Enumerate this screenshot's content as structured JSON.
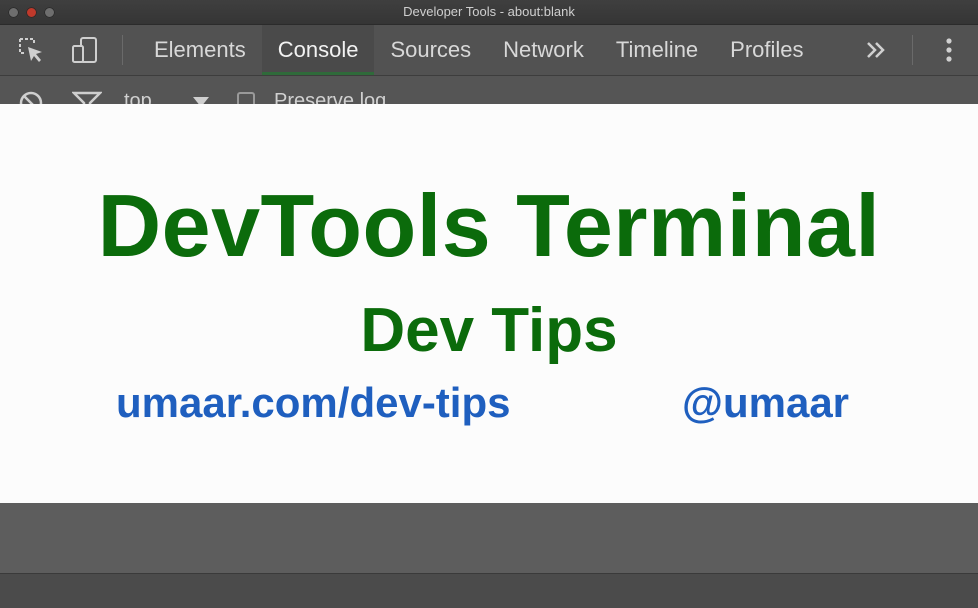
{
  "window": {
    "title": "Developer Tools - about:blank"
  },
  "toolbar": {
    "icons": {
      "inspect": "inspect-element-icon",
      "device": "device-mode-icon",
      "overflow": "chevron-double-right-icon",
      "menu": "kebab-menu-icon"
    },
    "tabs": [
      {
        "label": "Elements",
        "active": false
      },
      {
        "label": "Console",
        "active": true
      },
      {
        "label": "Sources",
        "active": false
      },
      {
        "label": "Network",
        "active": false
      },
      {
        "label": "Timeline",
        "active": false
      },
      {
        "label": "Profiles",
        "active": false
      }
    ]
  },
  "console_bar": {
    "context": "top",
    "preserve_log": "Preserve log"
  },
  "overlay": {
    "headline": "DevTools Terminal",
    "subline": "Dev Tips",
    "site": "umaar.com/dev-tips",
    "handle": "@umaar"
  },
  "colors": {
    "headline": "#0b6b0b",
    "link": "#1f5fbf",
    "active_tab_underline": "#2f6a3a"
  }
}
